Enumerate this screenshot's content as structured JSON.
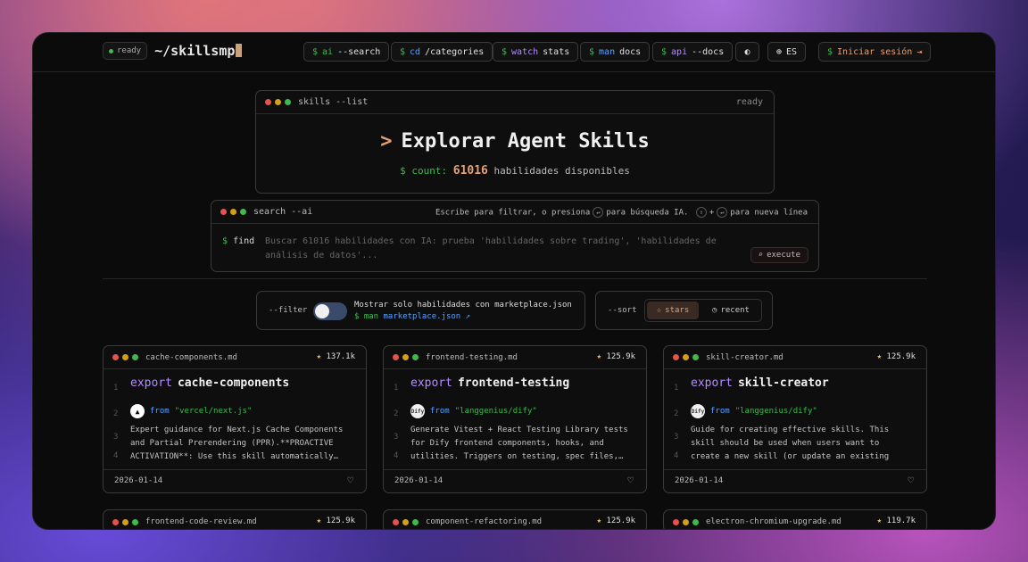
{
  "nav": {
    "ready": "ready",
    "brand": "~/skillsmp",
    "buttons": [
      {
        "prefix": "$",
        "cmd": "ai",
        "arg": "--search"
      },
      {
        "prefix": "$",
        "cmd": "cd",
        "arg": "/categories"
      },
      {
        "prefix": "$",
        "cmd": "watch",
        "arg": "stats"
      },
      {
        "prefix": "$",
        "cmd": "man",
        "arg": "docs"
      },
      {
        "prefix": "$",
        "cmd": "api",
        "arg": "--docs"
      }
    ],
    "lang": "ES",
    "login": {
      "prefix": "$",
      "label": "Iniciar sesión"
    }
  },
  "hero": {
    "head": "skills --list",
    "status": "ready",
    "prompt": ">",
    "title": "Explorar Agent Skills",
    "count_prefix": "$ count:",
    "count": "61016",
    "count_suffix": "habilidades disponibles"
  },
  "search": {
    "head": "search --ai",
    "hint_a": "Escribe para filtrar, o presiona",
    "hint_b": "para búsqueda IA.",
    "hint_c": "+",
    "hint_d": "para nueva línea",
    "prompt_dollar": "$",
    "prompt_cmd": "find",
    "placeholder": "Buscar 61016 habilidades con IA: prueba 'habilidades sobre trading', 'habilidades de análisis de datos'...",
    "execute": "execute"
  },
  "filter": {
    "label": "--filter",
    "text": "Mostrar solo habilidades con marketplace.json",
    "link_prefix": "$ man",
    "link": "marketplace.json"
  },
  "sort": {
    "label": "--sort",
    "stars": "stars",
    "recent": "recent"
  },
  "cards": [
    {
      "file": "cache-components.md",
      "stars": "137.1k",
      "kw": "export",
      "name": "cache-components",
      "from": "from",
      "repo": "\"vercel/next.js\"",
      "logo": "▲",
      "desc": "Expert guidance for Next.js Cache Components and Partial Prerendering (PPR).**PROACTIVE ACTIVATION**: Use this skill automatically…",
      "date": "2026-01-14"
    },
    {
      "file": "frontend-testing.md",
      "stars": "125.9k",
      "kw": "export",
      "name": "frontend-testing",
      "from": "from",
      "repo": "\"langgenius/dify\"",
      "logo": "Dify",
      "desc": "Generate Vitest + React Testing Library tests for Dify frontend components, hooks, and utilities. Triggers on testing, spec files,…",
      "date": "2026-01-14"
    },
    {
      "file": "skill-creator.md",
      "stars": "125.9k",
      "kw": "export",
      "name": "skill-creator",
      "from": "from",
      "repo": "\"langgenius/dify\"",
      "logo": "Dify",
      "desc": "Guide for creating effective skills. This skill should be used when users want to create a new skill (or update an existing skill) tha…",
      "date": "2026-01-14"
    }
  ],
  "cards_row2": [
    {
      "file": "frontend-code-review.md",
      "stars": "125.9k"
    },
    {
      "file": "component-refactoring.md",
      "stars": "125.9k"
    },
    {
      "file": "electron-chromium-upgrade.md",
      "stars": "119.7k"
    }
  ],
  "colors": {
    "accent": "#e8a070",
    "green": "#3fb950",
    "blue": "#5aa0ff",
    "purple": "#b58cff"
  }
}
